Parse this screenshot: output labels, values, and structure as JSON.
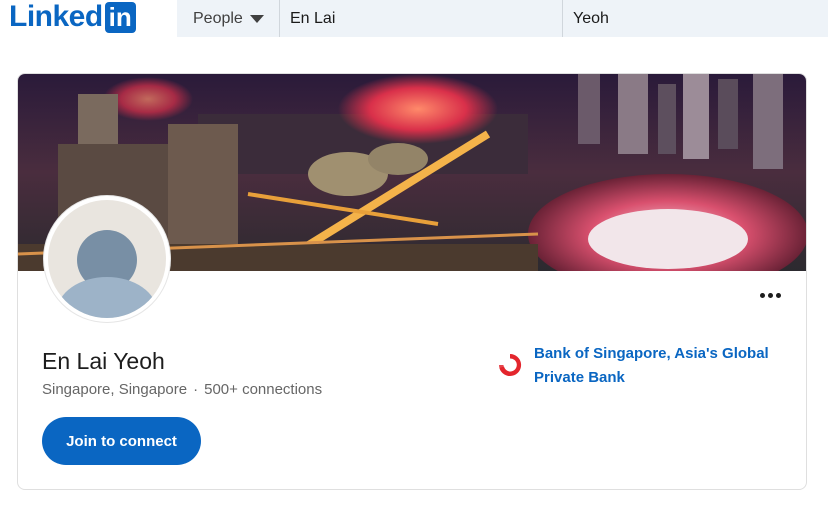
{
  "logo": {
    "text": "Linked",
    "box": "in"
  },
  "search": {
    "scope": "People",
    "first_name": "En Lai",
    "last_name": "Yeoh"
  },
  "profile": {
    "name": "En Lai Yeoh",
    "location": "Singapore, Singapore",
    "separator": "·",
    "connections": "500+ connections",
    "join_label": "Join to connect",
    "company": "Bank of Singapore, Asia's Global Private Bank"
  },
  "icons": {
    "more": "more-horizontal-icon",
    "caret": "caret-down-icon",
    "company_logo": "bank-of-singapore-logo"
  },
  "colors": {
    "brand": "#0a66c2",
    "search_bg": "#eef3f8",
    "company_logo": "#e3262d"
  }
}
